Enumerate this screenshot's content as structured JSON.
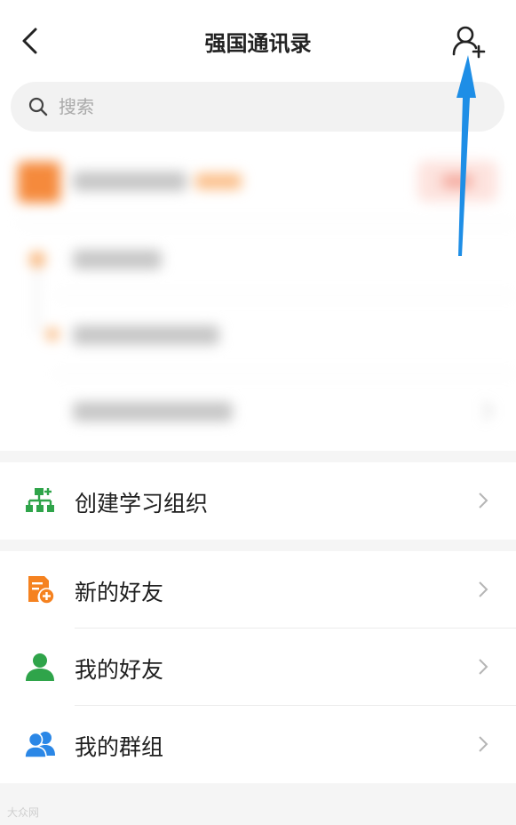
{
  "header": {
    "title": "强国通讯录",
    "back_icon": "chevron-left-icon",
    "add_icon": "add-contact-icon"
  },
  "search": {
    "placeholder": "搜索",
    "icon": "search-icon"
  },
  "organization_section": {
    "create_org_label": "创建学习组织",
    "create_org_icon": "org-chart-icon",
    "icon_color": "#2fa44a"
  },
  "contacts_section": {
    "items": [
      {
        "label": "新的好友",
        "icon": "new-friend-icon",
        "color": "#f58220"
      },
      {
        "label": "我的好友",
        "icon": "person-icon",
        "color": "#2fa44a"
      },
      {
        "label": "我的群组",
        "icon": "group-icon",
        "color": "#2b87e6"
      }
    ]
  },
  "annotation": {
    "arrow_color": "#1e8ee6"
  },
  "watermark": {
    "text": "大众网"
  }
}
